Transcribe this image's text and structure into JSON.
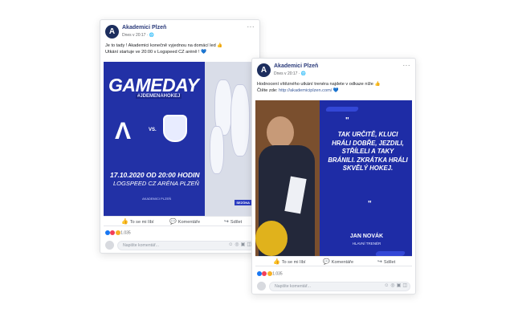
{
  "colors": {
    "brand_blue": "#2231a6",
    "link": "#385898",
    "card_border": "#dfe1e4"
  },
  "posts": [
    {
      "page_name": "Akademici Plzeň",
      "meta": "Dnes v 20:17 · ",
      "text_line1": "Je to tady ! Akademici konečně vyjednou na domácí led 👍",
      "text_line2": "Utkání startuje ve 20:00 v Logspeed CZ aréně ! 💙",
      "image": {
        "title": "GAMEDAY",
        "hashtag": "#JDEMENAHOKEJ",
        "vs": "VS.",
        "date": "17.10.2020 OD 20:00 HODIN",
        "venue": "LOGSPEED CZ ARÉNA PLZEŇ",
        "footer": "AKADEMICI PLZEŇ",
        "badge": "SEZÓNA"
      },
      "actions": {
        "like": "To se mi líbí",
        "comment": "Komentáře",
        "share": "Sdílet"
      },
      "reactions_count": "1.035",
      "comment_placeholder": "Napište komentář..."
    },
    {
      "page_name": "Akademici Plzeň",
      "meta": "Dnes v 20:17 · ",
      "text_line1": "Hodnocení vítězného utkání trenéra najdete v odkaze níže 👍",
      "text_line2_prefix": "Čtěte zde: ",
      "text_line2_link": "http://akademiciplzen.com/",
      "text_line2_suffix": " 💙",
      "image": {
        "quote": "TAK URČITĚ, KLUCI HRÁLI DOBŘE, JEZDILI, STŘÍLELI A TAKY BRÁNILI. ZKRÁTKA HRÁLI SKVĚLÝ HOKEJ.",
        "name": "JAN NOVÁK",
        "role": "HLAVNÍ TRENÉR"
      },
      "actions": {
        "like": "To se mi líbí",
        "comment": "Komentáře",
        "share": "Sdílet"
      },
      "reactions_count": "1.035",
      "comment_placeholder": "Napište komentář..."
    }
  ]
}
